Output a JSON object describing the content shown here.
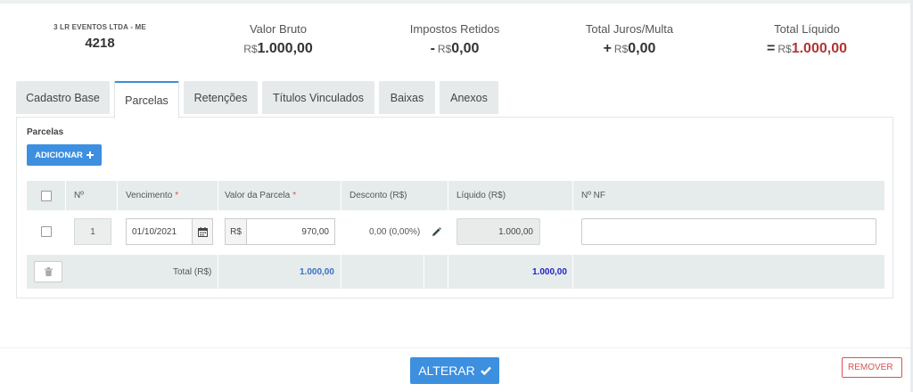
{
  "summary": {
    "company_name": "3 LR EVENTOS LTDA - ME",
    "company_code": "4218",
    "valor_bruto": {
      "label": "Valor Bruto",
      "currency": "R$",
      "value": "1.000,00"
    },
    "impostos": {
      "label": "Impostos Retidos",
      "operator": "-",
      "currency": "R$",
      "value": "0,00"
    },
    "juros": {
      "label": "Total Juros/Multa",
      "operator": "+",
      "currency": "R$",
      "value": "0,00"
    },
    "liquido": {
      "label": "Total Líquido",
      "operator": "=",
      "currency": "R$",
      "value": "1.000,00",
      "color": "#b03535"
    }
  },
  "tabs": [
    {
      "label": "Cadastro Base"
    },
    {
      "label": "Parcelas",
      "active": true
    },
    {
      "label": "Retenções"
    },
    {
      "label": "Títulos Vinculados"
    },
    {
      "label": "Baixas"
    },
    {
      "label": "Anexos"
    }
  ],
  "panel": {
    "title": "Parcelas",
    "add_button": "ADICIONAR"
  },
  "table": {
    "headers": {
      "num": "Nº",
      "vencimento": "Vencimento",
      "valor": "Valor da Parcela",
      "desconto": "Desconto (R$)",
      "liquido": "Líquido (R$)",
      "nf": "Nº NF"
    },
    "required_marker": "*",
    "row": {
      "index": "1",
      "vencimento": "01/10/2021",
      "currency": "R$",
      "valor": "970,00",
      "desconto": "0,00 (0,00%)",
      "liquido": "1.000,00",
      "nf": ""
    },
    "footer": {
      "total_label": "Total (R$)",
      "total_valor": "1.000,00",
      "total_liquido": "1.000,00"
    }
  },
  "actions": {
    "alterar": "ALTERAR",
    "remover": "REMOVER"
  },
  "colors": {
    "primary": "#3d8fe0",
    "danger": "#d9534f",
    "total_valor": "#3a6fc4",
    "total_liquido": "#2323c8"
  }
}
